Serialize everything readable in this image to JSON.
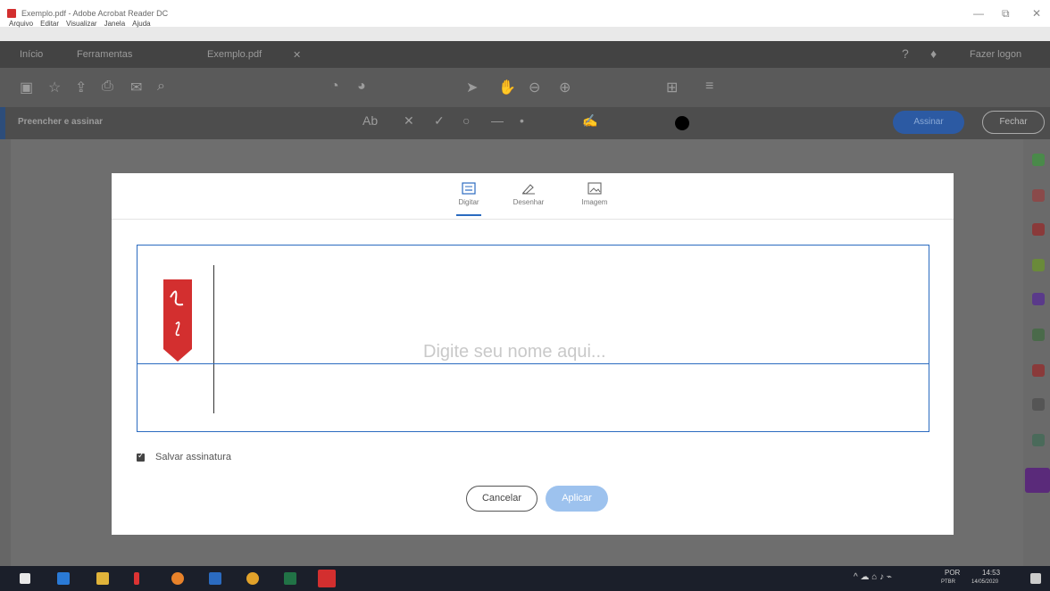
{
  "window": {
    "title": "Exemplo.pdf - Adobe Acrobat Reader DC",
    "menu": [
      "Arquivo",
      "Editar",
      "Visualizar",
      "Janela",
      "Ajuda"
    ],
    "controls": [
      "—",
      "⧉",
      "✕"
    ]
  },
  "tabs_bar": {
    "items": [
      "Início",
      "Ferramentas",
      "Exemplo.pdf"
    ],
    "user": "Fazer logon"
  },
  "toolbar2": {
    "section_title": "Preencher e assinar",
    "sign_button": "Assinar",
    "close_button": "Fechar"
  },
  "dialog": {
    "tabs": [
      {
        "label": "Digitar",
        "icon": "keyboard-icon"
      },
      {
        "label": "Desenhar",
        "icon": "pen-draw-icon"
      },
      {
        "label": "Imagem",
        "icon": "image-icon"
      }
    ],
    "placeholder": "Digite seu nome aqui...",
    "save_checkbox_label": "Salvar assinatura",
    "save_checked": true,
    "cancel_label": "Cancelar",
    "apply_label": "Aplicar"
  },
  "taskbar": {
    "lang": "POR",
    "lang_sub": "PTBR",
    "time": "14:53",
    "date": "14/05/2020"
  },
  "colors": {
    "accent": "#2b6bc0",
    "apply_disabled": "#9dc2ee",
    "acrobat_red": "#d32f2f"
  }
}
